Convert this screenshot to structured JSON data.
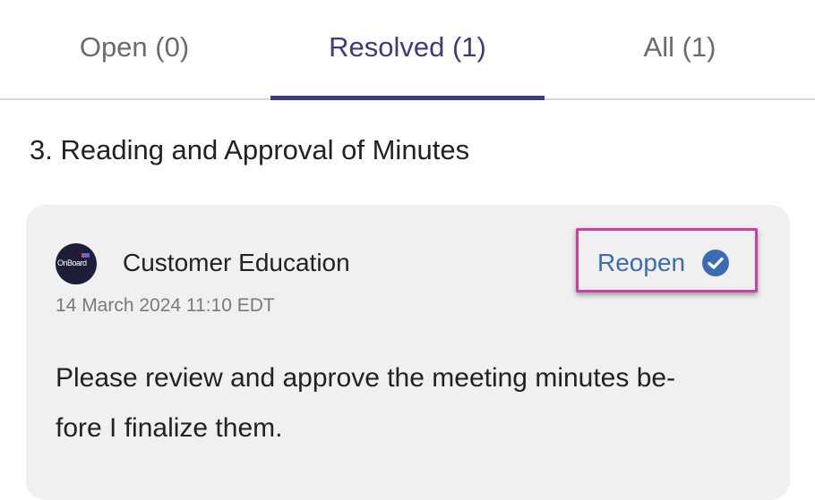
{
  "tabs": {
    "open_label": "Open (0)",
    "resolved_label": "Resolved (1)",
    "all_label": "All (1)"
  },
  "section": {
    "title": "3. Reading and Approval of Minutes"
  },
  "comment": {
    "avatar_text": "OnBoard",
    "author": "Customer Education",
    "timestamp": "14 March 2024 11:10 EDT",
    "reopen_label": "Reopen",
    "message_line1": "Please review and approve the meeting minutes be-",
    "message_line2": "fore I finalize them."
  },
  "colors": {
    "accent": "#3d3a7e",
    "link": "#3a6bb5",
    "highlight": "#c83fa6",
    "card_bg": "#f0f0f0"
  },
  "icons": {
    "resolved_status": "check-circle-icon"
  }
}
